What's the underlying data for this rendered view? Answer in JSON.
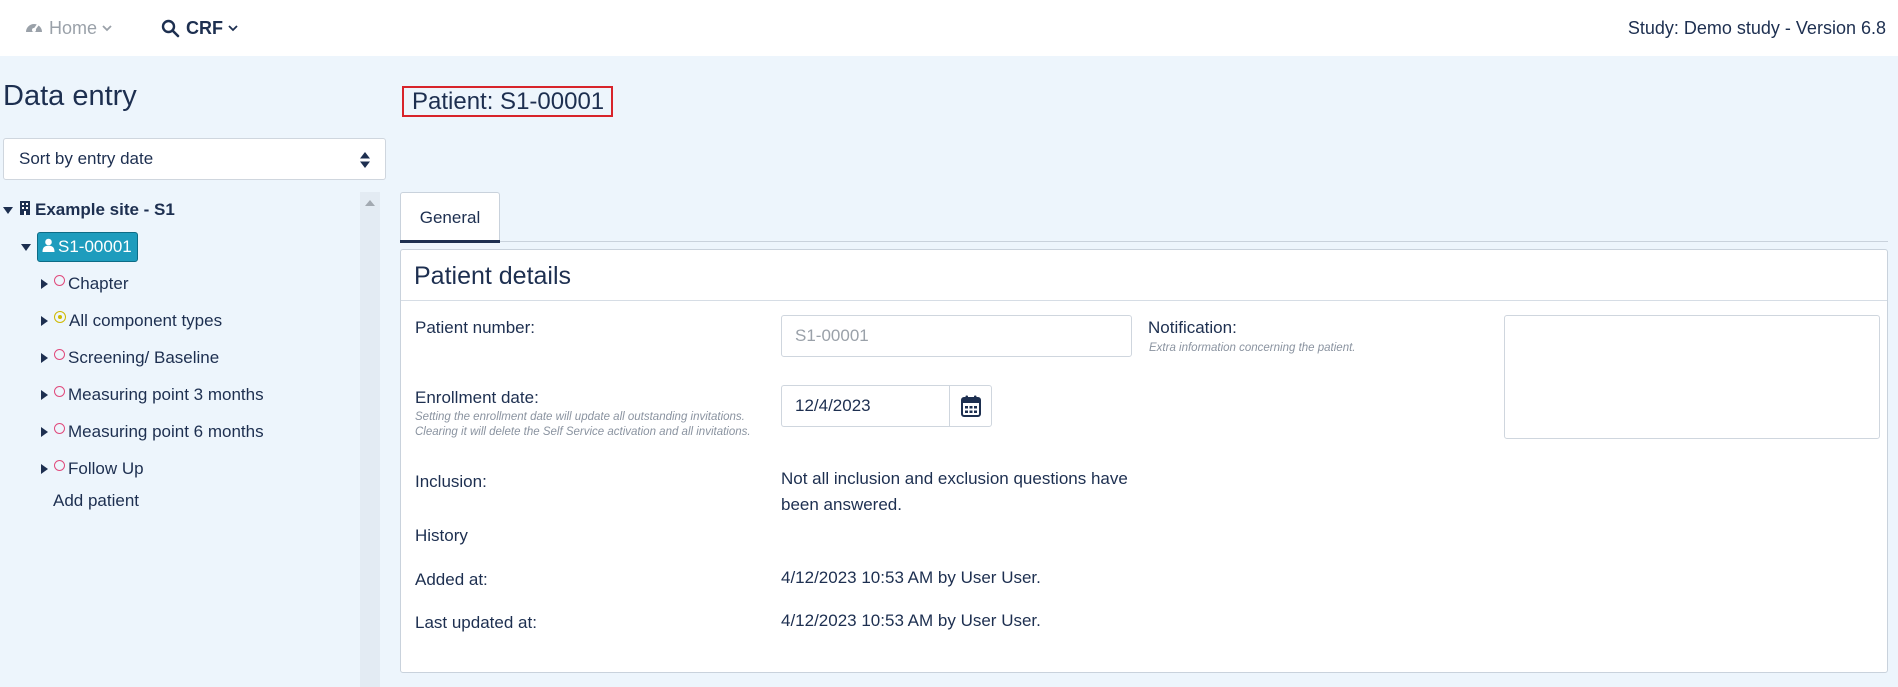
{
  "nav": {
    "home_label": "Home",
    "crf_label": "CRF",
    "study_label": "Study: Demo study - Version 6.8"
  },
  "sidebar": {
    "title": "Data entry",
    "sort_value": "Sort by entry date",
    "site_label": "Example site - S1",
    "patient_label": "S1-00001",
    "items": [
      {
        "label": "Chapter",
        "status": "empty"
      },
      {
        "label": "All component types",
        "status": "partial"
      },
      {
        "label": "Screening/ Baseline",
        "status": "empty"
      },
      {
        "label": "Measuring point 3 months",
        "status": "empty"
      },
      {
        "label": "Measuring point 6 months",
        "status": "empty"
      },
      {
        "label": "Follow Up",
        "status": "empty"
      }
    ],
    "add_patient": "Add patient"
  },
  "main": {
    "patient_header": "Patient: S1-00001",
    "tab_general": "General",
    "card_title": "Patient details",
    "patient_number_label": "Patient number:",
    "patient_number_placeholder": "S1-00001",
    "notification_label": "Notification:",
    "notification_hint": "Extra information concerning the patient.",
    "enrollment_label": "Enrollment date:",
    "enrollment_hint": "Setting the enrollment date will update all outstanding invitations. Clearing it will delete the Self Service activation and all invitations.",
    "enrollment_value": "12/4/2023",
    "inclusion_label": "Inclusion:",
    "inclusion_value": "Not all inclusion and exclusion questions have been answered.",
    "history_label": "History",
    "added_label": "Added at:",
    "added_value": "4/12/2023 10:53 AM by User User.",
    "updated_label": "Last updated at:",
    "updated_value": "4/12/2023 10:53 AM by User User."
  },
  "colors": {
    "accent": "#1e9cbd",
    "text": "#1d2f50",
    "highlight_border": "#d8232a",
    "status_empty": "#e04a7c",
    "status_partial": "#cfb900"
  }
}
